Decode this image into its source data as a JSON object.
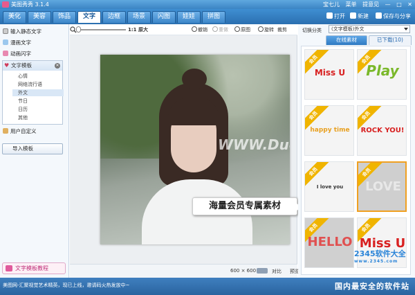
{
  "titlebar": {
    "title": "美图秀秀 3.1.4",
    "user": "宝七儿",
    "menu": "菜单",
    "feedback": "提意见"
  },
  "tabs": [
    {
      "label": "美化"
    },
    {
      "label": "美容"
    },
    {
      "label": "饰品"
    },
    {
      "label": "文字"
    },
    {
      "label": "边框"
    },
    {
      "label": "场景"
    },
    {
      "label": "闪图"
    },
    {
      "label": "娃娃"
    },
    {
      "label": "拼图"
    }
  ],
  "topactions": {
    "open": "打开",
    "new": "新建",
    "save": "保存与分享"
  },
  "leftpanel": {
    "static_text": "输入静态文字",
    "comic_text": "漫画文字",
    "flash_text": "动画闪字",
    "template_header": "文字模板",
    "subcats": [
      "心情",
      "网络流行语",
      "外文",
      "节日",
      "日历",
      "其他"
    ],
    "custom": "用户自定义",
    "import": "导入模板",
    "tutorial": "文字模板教程"
  },
  "toolbar": {
    "zoom": "1:1 原大",
    "undo": "撤销",
    "redo": "重做",
    "original": "原图",
    "rotate": "旋转",
    "crop": "裁剪",
    "size": "尺寸"
  },
  "canvas": {
    "watermark": "WWW.DuoTe.com",
    "promo": "海量会员专属素材"
  },
  "statusbar": {
    "dimensions": "600 × 600",
    "compare": "对比",
    "preview": "预览"
  },
  "rightpanel": {
    "category_label": "切换分类",
    "category_value": "(文字模板)外文",
    "tab_online": "在线素材",
    "tab_downloaded": "已下载(10)",
    "items": [
      {
        "badge": "会员",
        "art": "Miss U",
        "color": "#d82020"
      },
      {
        "badge": "会员",
        "art": "Play",
        "color": "#7ab82a"
      },
      {
        "badge": "会员",
        "art": "happy time",
        "color": "#e8a020"
      },
      {
        "badge": "会员",
        "art": "ROCK YOU!",
        "color": "#d82020"
      },
      {
        "badge": "会员",
        "art": "I love you",
        "color": "#333333"
      },
      {
        "badge": "会员",
        "art": "LOVE",
        "color": "#dddddd"
      },
      {
        "badge": "会员",
        "art": "HELLO",
        "color": "#e05050"
      },
      {
        "badge": "会员",
        "art": "Miss U",
        "color": "#d82020"
      }
    ]
  },
  "bottombar": {
    "message": "美图网-汇聚视觉艺术精英，现已上线，邀请码火热发放中~",
    "brand": "国内最安全的软件站"
  },
  "watermark": {
    "site": "2345软件大全",
    "url": "www.2345.com"
  }
}
